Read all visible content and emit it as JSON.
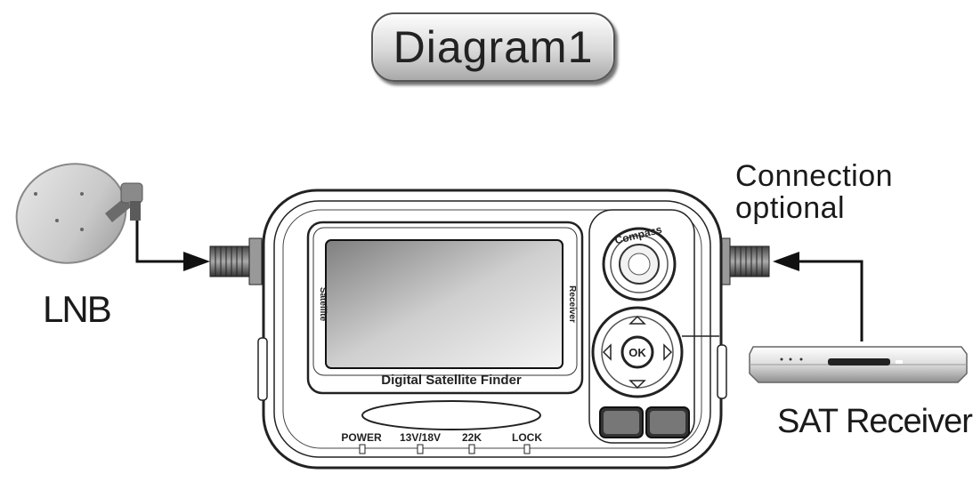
{
  "title": "Diagram1",
  "labels": {
    "lnb": "LNB",
    "connection_line1": "Connection",
    "connection_line2": "optional",
    "sat_receiver": "SAT Receiver"
  },
  "device": {
    "brand_strip": "Digital Satellite Finder",
    "side_left": "Satellite",
    "side_right": "Receiver",
    "compass_label": "Compass",
    "ok_label": "OK",
    "indicators": [
      "POWER",
      "13V/18V",
      "22K",
      "LOCK"
    ]
  },
  "colors": {
    "line": "#222222",
    "pill_light": "#fdfdfd",
    "pill_dark": "#a9a9a9"
  }
}
